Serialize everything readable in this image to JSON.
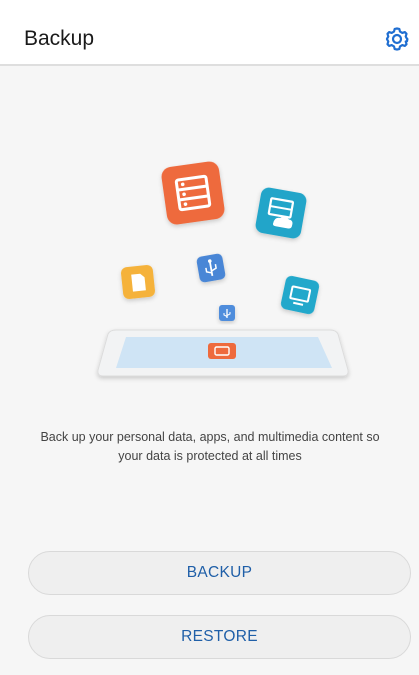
{
  "header": {
    "title": "Backup",
    "settings_icon": "gear-icon"
  },
  "illustration": {
    "icons": [
      "document-list-icon",
      "cloud-storage-icon",
      "sd-card-icon",
      "usb-icon",
      "usb-small-icon",
      "monitor-icon",
      "phone-icon"
    ]
  },
  "main": {
    "description": "Back up your personal data, apps, and multimedia content so your data is protected at all times"
  },
  "actions": {
    "backup_label": "BACKUP",
    "restore_label": "RESTORE"
  },
  "colors": {
    "accent": "#1f5fa8",
    "orange": "#ef6a3e",
    "teal": "#21a6c8",
    "yellow": "#f6b239",
    "blue": "#4b86d6"
  }
}
